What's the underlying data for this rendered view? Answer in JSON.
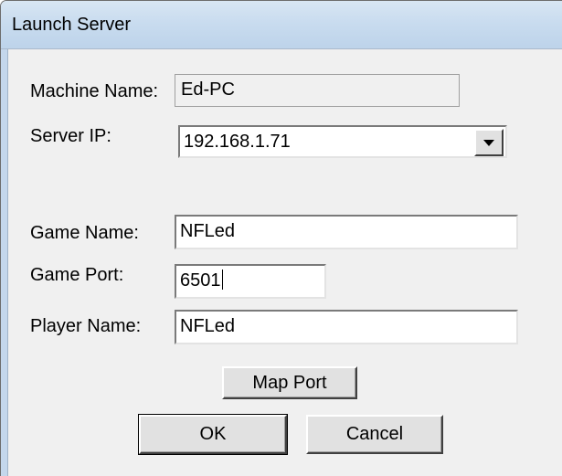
{
  "window": {
    "title": "Launch Server"
  },
  "form": {
    "machine_name": {
      "label": "Machine Name:",
      "value": "Ed-PC"
    },
    "server_ip": {
      "label": "Server IP:",
      "value": "192.168.1.71",
      "dropdown_icon": "chevron-down-icon"
    },
    "game_name": {
      "label": "Game Name:",
      "value": "NFLed"
    },
    "game_port": {
      "label": "Game Port:",
      "value": "6501"
    },
    "player_name": {
      "label": "Player Name:",
      "value": "NFLed"
    }
  },
  "buttons": {
    "map_port": "Map Port",
    "ok": "OK",
    "cancel": "Cancel"
  },
  "colors": {
    "title_bar": "#c9dcef",
    "dialog_background": "#f0f0f0",
    "field_background": "#ffffff"
  }
}
